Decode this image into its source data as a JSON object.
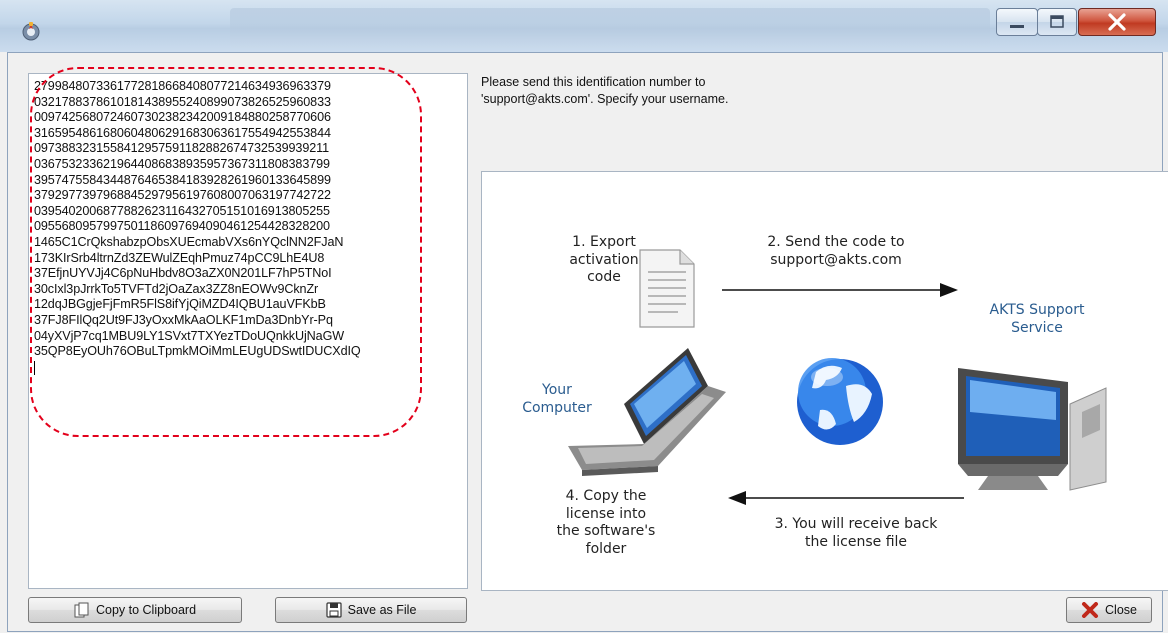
{
  "window": {
    "title": ""
  },
  "activation_code": {
    "lines": [
      "2799848073361772818668408077214634936963379",
      "0321788378610181438955240899073826525960833",
      "0097425680724607302382342009184880258770606",
      "3165954861680604806291683063617554942553844",
      "0973883231558412957591182882674732539939211",
      "0367532336219644086838935957367311808383799",
      "3957475584344876465384183928261960133645899",
      "3792977397968845297956197608007063197742722",
      "0395402006877882623116432705151016913805255",
      "0955680957997501186097694090461254428328200",
      "1465C1CrQkshabzpObsXUEcmabVXs6nYQclNN2FJaN",
      "173KIrSrb4ltrnZd3ZEWulZEqhPmuz74pCC9LhE4U8",
      "37EfjnUYVJj4C6pNuHbdv8O3aZX0N201LF7hP5TNoI",
      "30cIxl3pJrrkTo5TVFTd2jOaZax3ZZ8nEOWv9CknZr",
      "12dqJBGgjeFjFmR5FlS8ifYjQiMZD4IQBU1auVFKbB",
      "37FJ8FIlQq2Ut9FJ3yOxxMkAaOLKF1mDa3DnbYr-Pq",
      "04yXVjP7cq1MBU9LY1SVxt7TXYezTDoUQnkkUjNaGW",
      "35QP8EyOUh76OBuLTpmkMOiMmLEUgUDSwtIDUCXdIQ"
    ]
  },
  "message": {
    "line1": "Please send this identification number to",
    "line2": "'support@akts.com'. Specify your username."
  },
  "diagram": {
    "step1": [
      "1. Export",
      "activation",
      "code"
    ],
    "step2": [
      "2. Send the code to",
      "support@akts.com"
    ],
    "service": [
      "AKTS Support",
      "Service"
    ],
    "computer": [
      "Your",
      "Computer"
    ],
    "step3": [
      "3. You will receive back",
      "the license file"
    ],
    "step4": [
      "4. Copy the",
      "license into",
      "the software's",
      "folder"
    ]
  },
  "buttons": {
    "copy": "Copy to Clipboard",
    "save": "Save as File",
    "close": "Close"
  },
  "icons": {
    "app": "app-icon",
    "copy": "copy-icon",
    "save": "floppy-disk-icon",
    "close": "red-x-icon"
  },
  "colors": {
    "highlight": "#e3001b",
    "label_blue": "#2a5c8f",
    "close_red": "#c03a22"
  }
}
